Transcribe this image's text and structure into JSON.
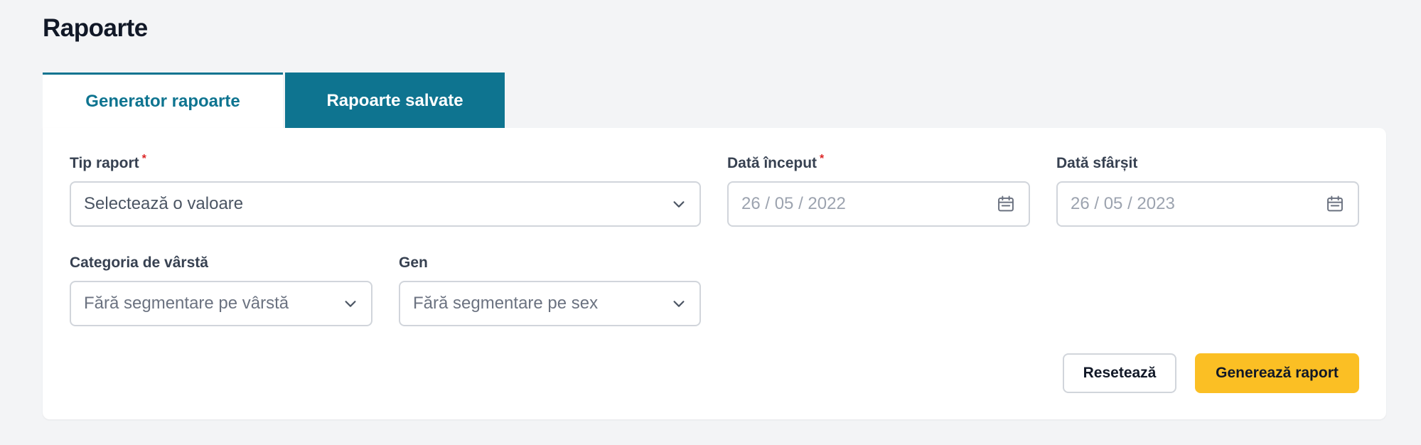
{
  "page": {
    "title": "Rapoarte"
  },
  "tabs": [
    {
      "label": "Generator rapoarte",
      "active": true
    },
    {
      "label": "Rapoarte salvate",
      "active": false
    }
  ],
  "form": {
    "report_type": {
      "label": "Tip raport",
      "required_mark": "*",
      "value": "Selectează o valoare"
    },
    "start_date": {
      "label": "Dată început",
      "required_mark": "*",
      "value": "26 / 05 / 2022"
    },
    "end_date": {
      "label": "Dată sfârșit",
      "value": "26 / 05 / 2023"
    },
    "age_category": {
      "label": "Categoria de vârstă",
      "value": "Fără segmentare pe vârstă"
    },
    "gender": {
      "label": "Gen",
      "value": "Fără segmentare pe sex"
    }
  },
  "actions": {
    "reset_label": "Resetează",
    "generate_label": "Generează raport"
  },
  "colors": {
    "primary": "#0e7490",
    "accent": "#fbbf24",
    "required": "#dc2626"
  },
  "icons": {
    "dropdown": "chevron-down-icon",
    "date": "calendar-icon"
  }
}
